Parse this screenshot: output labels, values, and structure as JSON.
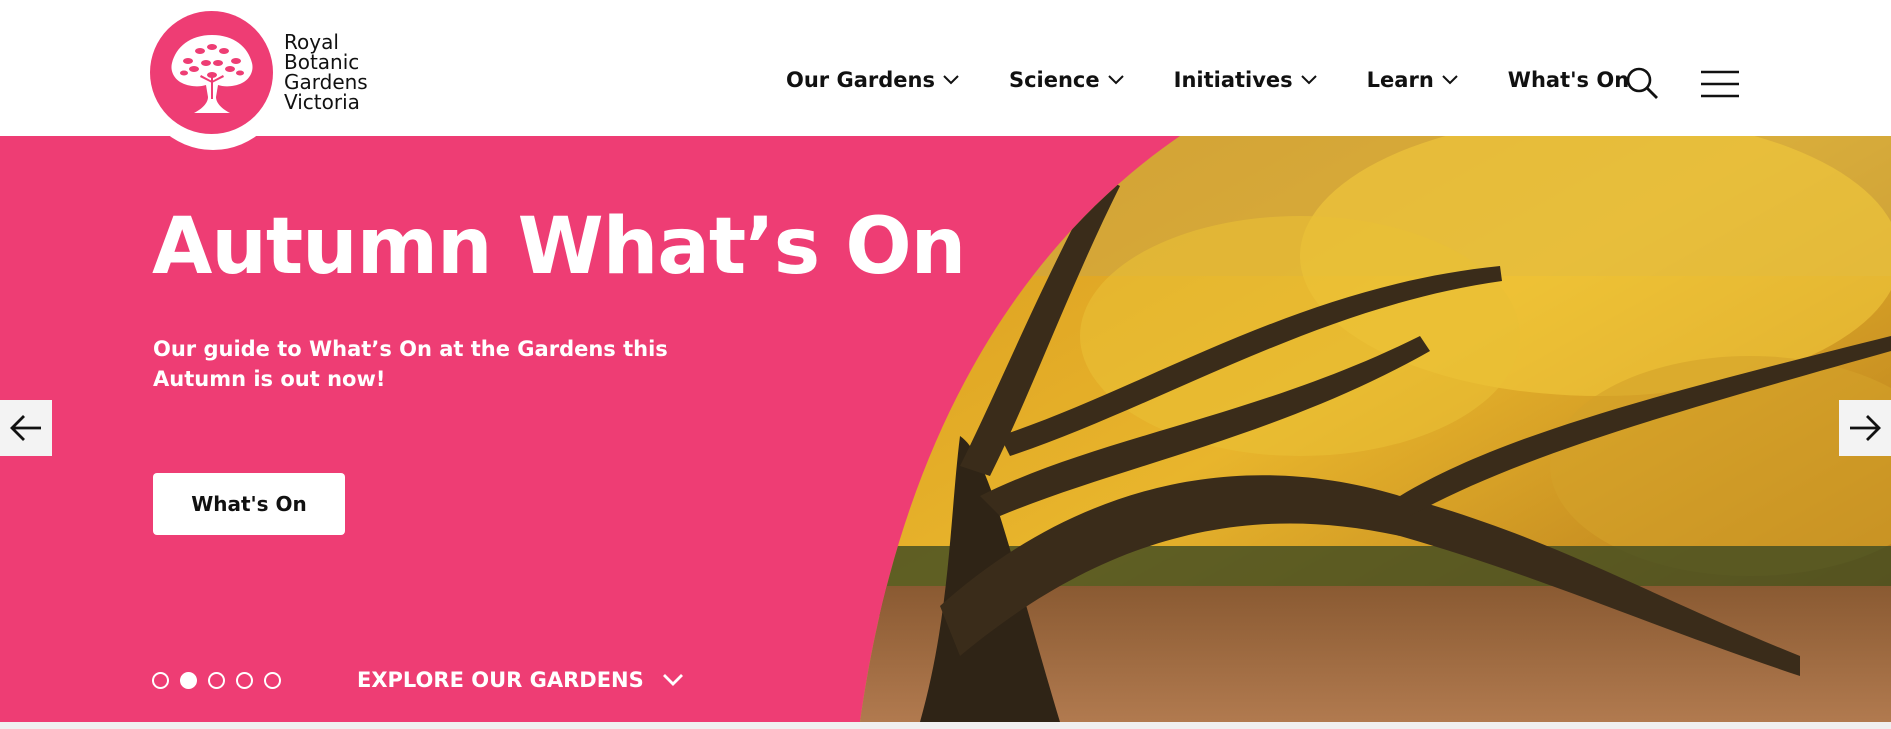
{
  "brand": {
    "lines": [
      "Royal",
      "Botanic",
      "Gardens",
      "Victoria"
    ],
    "color": "#ee3d74"
  },
  "nav": {
    "items": [
      {
        "label": "Our Gardens",
        "has_dropdown": true
      },
      {
        "label": "Science",
        "has_dropdown": true
      },
      {
        "label": "Initiatives",
        "has_dropdown": true
      },
      {
        "label": "Learn",
        "has_dropdown": true
      },
      {
        "label": "What's On",
        "has_dropdown": false
      }
    ],
    "search_icon": "search-icon",
    "menu_icon": "hamburger-menu-icon"
  },
  "hero": {
    "title": "Autumn What’s On",
    "subtitle": "Our guide to What’s On at the Gardens this Autumn is out now!",
    "cta_label": "What's On",
    "background_color": "#ee3d74",
    "image_description_icon": "autumn-tree-image",
    "prev_icon": "arrow-left-icon",
    "next_icon": "arrow-right-icon",
    "slides_total": 5,
    "active_slide": 2,
    "explore_label": "EXPLORE OUR GARDENS"
  }
}
